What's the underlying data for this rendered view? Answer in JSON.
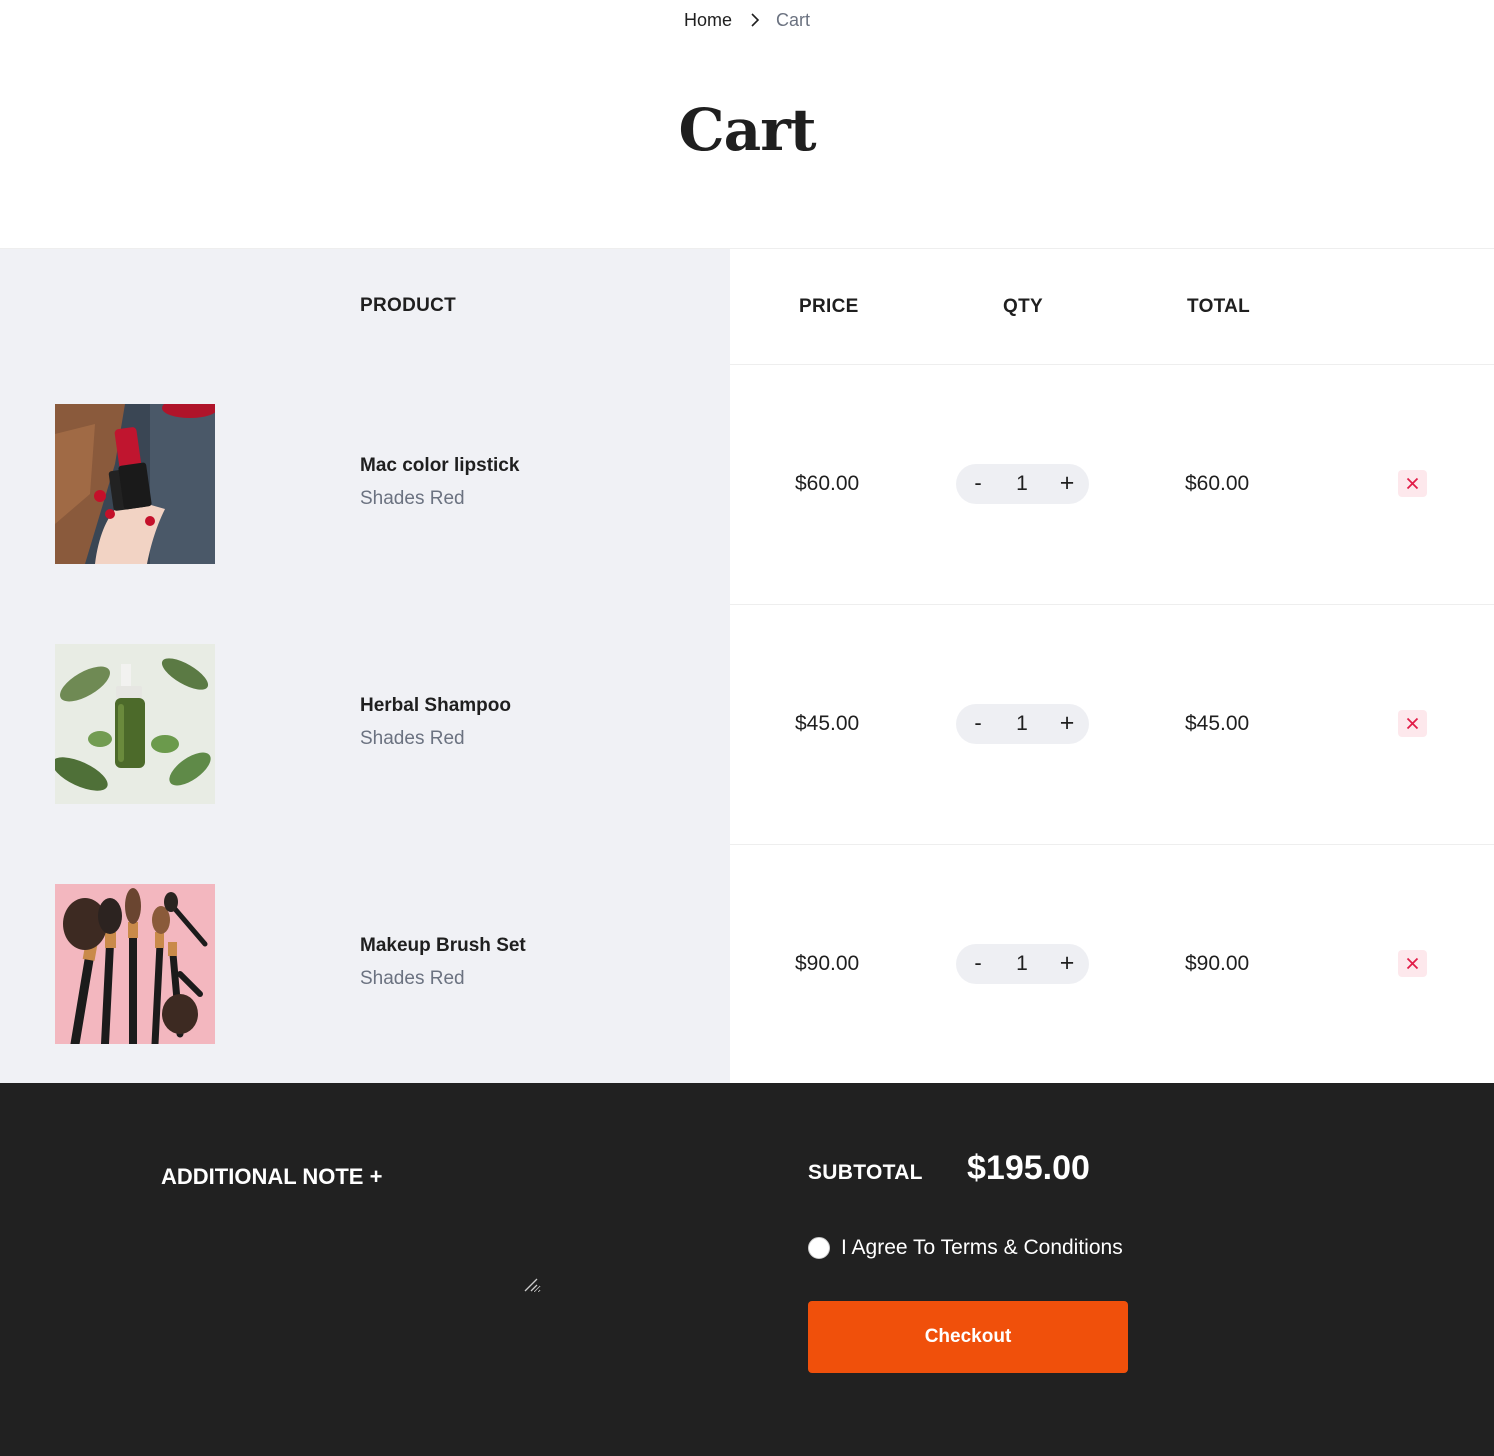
{
  "breadcrumb": {
    "home": "Home",
    "separator_icon": "chevron-right-icon",
    "current": "Cart"
  },
  "page_title": "Cart",
  "table_headers": {
    "product": "PRODUCT",
    "price": "PRICE",
    "qty": "QTY",
    "total": "TOTAL"
  },
  "items": [
    {
      "name": "Mac color lipstick",
      "variant": "Shades Red",
      "price": "$60.00",
      "qty_minus": "-",
      "qty": "1",
      "qty_plus": "+",
      "total": "$60.00",
      "remove_icon": "close-icon"
    },
    {
      "name": "Herbal Shampoo",
      "variant": "Shades Red",
      "price": "$45.00",
      "qty_minus": "-",
      "qty": "1",
      "qty_plus": "+",
      "total": "$45.00",
      "remove_icon": "close-icon"
    },
    {
      "name": "Makeup Brush Set",
      "variant": "Shades Red",
      "price": "$90.00",
      "qty_minus": "-",
      "qty": "1",
      "qty_plus": "+",
      "total": "$90.00",
      "remove_icon": "close-icon"
    }
  ],
  "footer": {
    "note_title": "ADDITIONAL NOTE +",
    "note_value": "",
    "subtotal_label": "SUBTOTAL",
    "subtotal_value": "$195.00",
    "terms_label": "I Agree To Terms & Conditions",
    "terms_checked": false,
    "checkout_label": "Checkout"
  },
  "colors": {
    "left_panel_bg": "#f0f1f5",
    "footer_bg": "#212121",
    "checkout_bg": "#f0500b",
    "remove_bg": "#fde8ec",
    "remove_icon": "#e11d48",
    "muted_text": "#6b7280"
  }
}
